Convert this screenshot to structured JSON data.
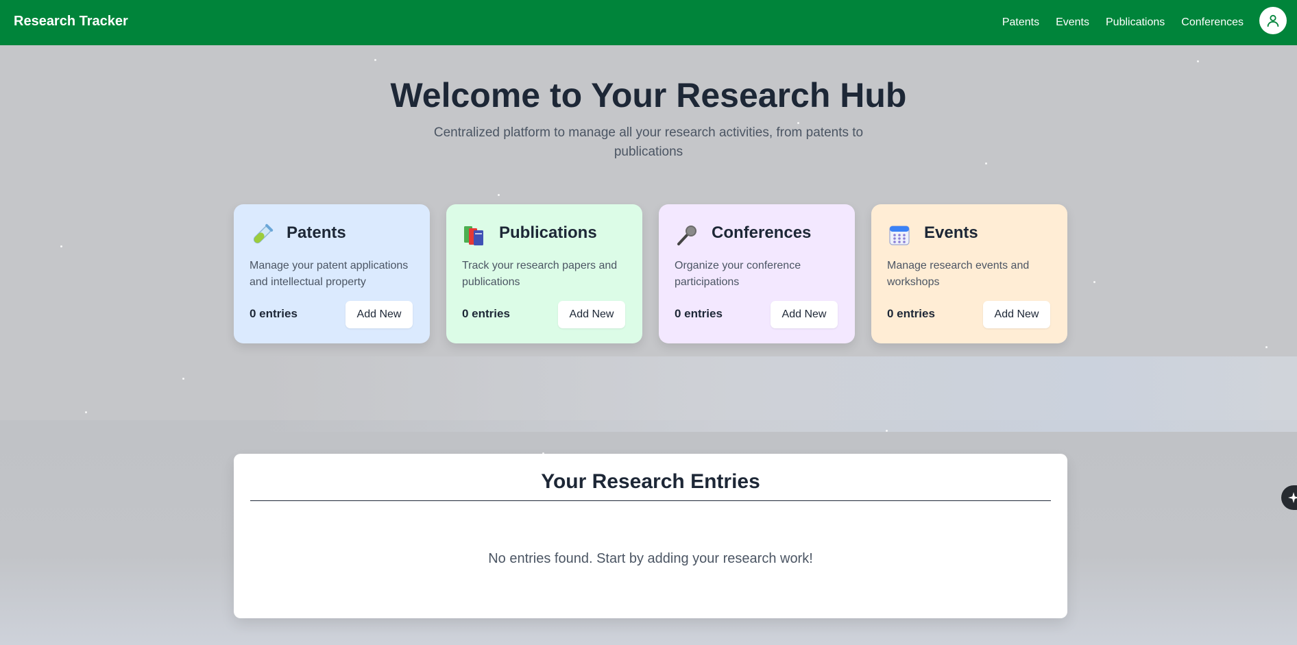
{
  "navbar": {
    "brand": "Research Tracker",
    "links": [
      "Patents",
      "Events",
      "Publications",
      "Conferences"
    ]
  },
  "hero": {
    "title": "Welcome to Your Research Hub",
    "subtitle": "Centralized platform to manage all your research activities, from patents to publications"
  },
  "cards": [
    {
      "title": "Patents",
      "description": "Manage your patent applications and intellectual property",
      "count": "0 entries",
      "button": "Add New",
      "icon": "test-tube-icon",
      "color": "#dbeafe"
    },
    {
      "title": "Publications",
      "description": "Track your research papers and publications",
      "count": "0 entries",
      "button": "Add New",
      "icon": "books-icon",
      "color": "#dcfce7"
    },
    {
      "title": "Conferences",
      "description": "Organize your conference participations",
      "count": "0 entries",
      "button": "Add New",
      "icon": "microphone-icon",
      "color": "#f3e8ff"
    },
    {
      "title": "Events",
      "description": "Manage research events and workshops",
      "count": "0 entries",
      "button": "Add New",
      "icon": "calendar-icon",
      "color": "#ffedd5"
    }
  ],
  "entries": {
    "title": "Your Research Entries",
    "empty_message": "No entries found. Start by adding your research work!"
  },
  "colors": {
    "navbar": "#00843a",
    "text_dark": "#1d2736",
    "text_muted": "#4b5563"
  }
}
